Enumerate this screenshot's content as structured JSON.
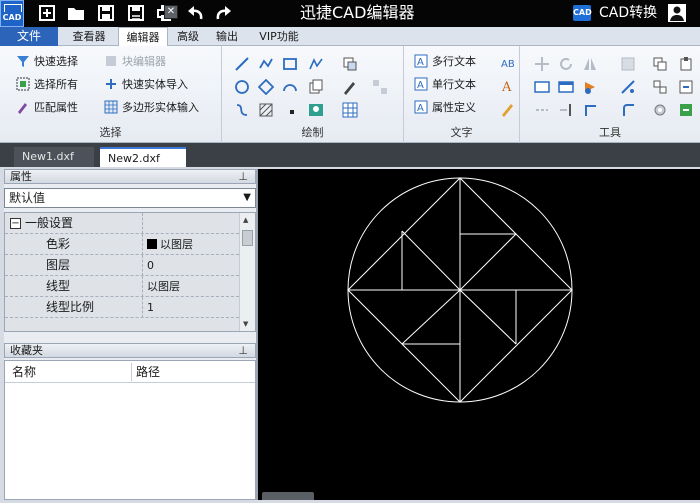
{
  "app": {
    "title": "迅捷CAD编辑器",
    "logo_text": "CAD",
    "cad_convert_label": "CAD转换",
    "cad_convert_icon_text": "CAD"
  },
  "quick_access": [
    "new-icon",
    "open-icon",
    "save-icon",
    "save-as-icon",
    "print-icon",
    "undo-icon",
    "redo-icon"
  ],
  "tabs": [
    {
      "label": "文件",
      "active": false
    },
    {
      "label": "查看器",
      "active": false
    },
    {
      "label": "编辑器",
      "active": true
    },
    {
      "label": "高级",
      "active": false
    },
    {
      "label": "输出",
      "active": false
    },
    {
      "label": "VIP功能",
      "active": false
    }
  ],
  "ribbon": {
    "select_group": {
      "label": "选择",
      "items": [
        "快速选择",
        "块编辑器",
        "选择所有",
        "快速实体导入",
        "匹配属性",
        "多边形实体输入"
      ]
    },
    "draw_group": {
      "label": "绘制"
    },
    "text_group": {
      "label": "文字",
      "items": [
        "多行文本",
        "单行文本",
        "属性定义"
      ]
    },
    "tools_group": {
      "label": "工具"
    }
  },
  "documents": [
    {
      "name": "New1.dxf",
      "active": false
    },
    {
      "name": "New2.dxf",
      "active": true
    }
  ],
  "properties": {
    "title": "属性",
    "selector_value": "默认值",
    "section_header": "一般设置",
    "rows": [
      {
        "name": "色彩",
        "value": "以图层",
        "swatch": "#000000"
      },
      {
        "name": "图层",
        "value": "0"
      },
      {
        "name": "线型",
        "value": "以图层"
      },
      {
        "name": "线型比例",
        "value": "1"
      }
    ]
  },
  "favorites": {
    "title": "收藏夹",
    "columns": [
      "名称",
      "路径"
    ]
  },
  "colors": {
    "title_bar": "#050505",
    "file_tab": "#2b64b8",
    "canvas": "#000000",
    "drawing_stroke": "#ffffff"
  }
}
